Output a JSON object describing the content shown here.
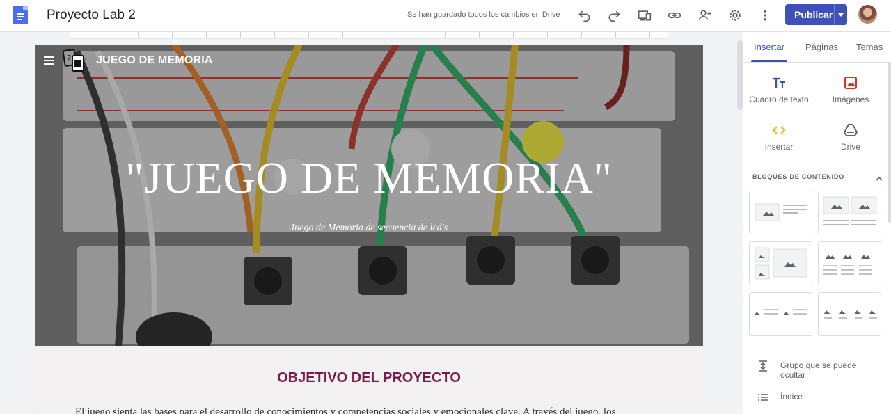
{
  "app": {
    "document_title": "Proyecto Lab 2",
    "save_status": "Se han guardado todos los cambios en Drive",
    "publish_label": "Publicar"
  },
  "toolbar_icons": [
    "undo-icon",
    "redo-icon",
    "preview-icon",
    "link-icon",
    "share-icon",
    "settings-icon",
    "more-vert-icon"
  ],
  "site": {
    "name": "JUEGO DE MEMORIA",
    "hero_title": "\"JUEGO DE MEMORIA\"",
    "hero_subtitle": "Juego de Memoria de secuencia de led's",
    "section_title": "OBJETIVO DEL PROYECTO",
    "body_text": "El juego sienta las bases para el desarrollo de conocimientos y competencias sociales y emocionales clave. A través del juego, los"
  },
  "panel": {
    "tabs": [
      {
        "label": "Insertar",
        "active": true
      },
      {
        "label": "Páginas",
        "active": false
      },
      {
        "label": "Temas",
        "active": false
      }
    ],
    "insert_items": [
      {
        "label": "Cuadro de texto",
        "icon": "text-box-icon"
      },
      {
        "label": "Imágenes",
        "icon": "image-icon"
      },
      {
        "label": "Insertar",
        "icon": "embed-icon"
      },
      {
        "label": "Drive",
        "icon": "drive-icon"
      }
    ],
    "blocks_label": "BLOQUES DE CONTENIDO",
    "other_items": [
      {
        "label": "Grupo que se puede ocultar",
        "icon": "collapsible-group-icon"
      },
      {
        "label": "Índice",
        "icon": "table-of-contents-icon"
      }
    ]
  },
  "colors": {
    "accent": "#3f51b5",
    "section_title": "#7a1a4b",
    "image_icon": "#d93025",
    "embed_icon": "#f9ab00"
  }
}
